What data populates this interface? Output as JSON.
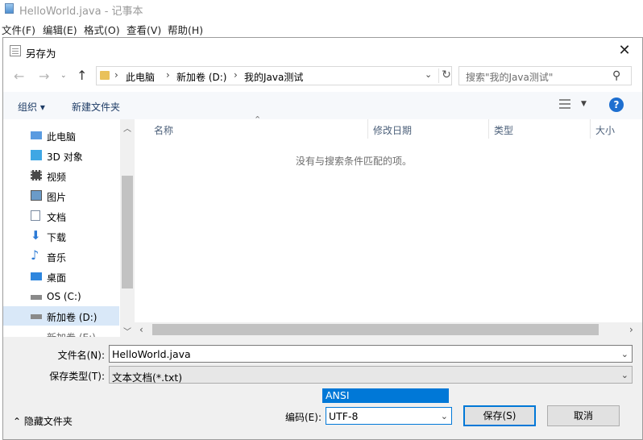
{
  "notepad": {
    "title": "HelloWorld.java - 记事本",
    "menus": [
      "文件(F)",
      "编辑(E)",
      "格式(O)",
      "查看(V)",
      "帮助(H)"
    ]
  },
  "dialog": {
    "title": "另存为",
    "close": "✕",
    "address": {
      "crumbs": [
        "此电脑",
        "新加卷 (D:)",
        "我的Java测试"
      ]
    },
    "search": {
      "placeholder": "搜索\"我的Java测试\""
    },
    "toolbar": {
      "organize": "组织 ▾",
      "new_folder": "新建文件夹",
      "help": "?"
    },
    "nav": {
      "items": [
        {
          "label": "此电脑",
          "icon": "computer-icon"
        },
        {
          "label": "3D 对象",
          "icon": "cube-icon"
        },
        {
          "label": "视频",
          "icon": "video-icon"
        },
        {
          "label": "图片",
          "icon": "picture-icon"
        },
        {
          "label": "文档",
          "icon": "document-icon"
        },
        {
          "label": "下载",
          "icon": "download-icon"
        },
        {
          "label": "音乐",
          "icon": "music-icon"
        },
        {
          "label": "桌面",
          "icon": "desktop-icon"
        },
        {
          "label": "OS (C:)",
          "icon": "drive-icon"
        },
        {
          "label": "新加卷 (D:)",
          "icon": "drive-icon",
          "selected": true
        },
        {
          "label": "新加卷 (E:)",
          "icon": "drive-icon"
        }
      ]
    },
    "columns": [
      "名称",
      "修改日期",
      "类型",
      "大小"
    ],
    "empty_message": "没有与搜索条件匹配的项。",
    "form": {
      "filename_label": "文件名(N):",
      "filename_value": "HelloWorld.java",
      "type_label": "保存类型(T):",
      "type_value": "文本文档(*.txt)",
      "encoding_label": "编码(E):",
      "encoding_value": "UTF-8",
      "encoding_option": "ANSI",
      "save": "保存(S)",
      "cancel": "取消",
      "hide_folders": "隐藏文件夹"
    }
  },
  "colors": {
    "accent": "#0078d7",
    "selected_bg": "#d9e8f8",
    "help_blue": "#1e6fd0"
  }
}
